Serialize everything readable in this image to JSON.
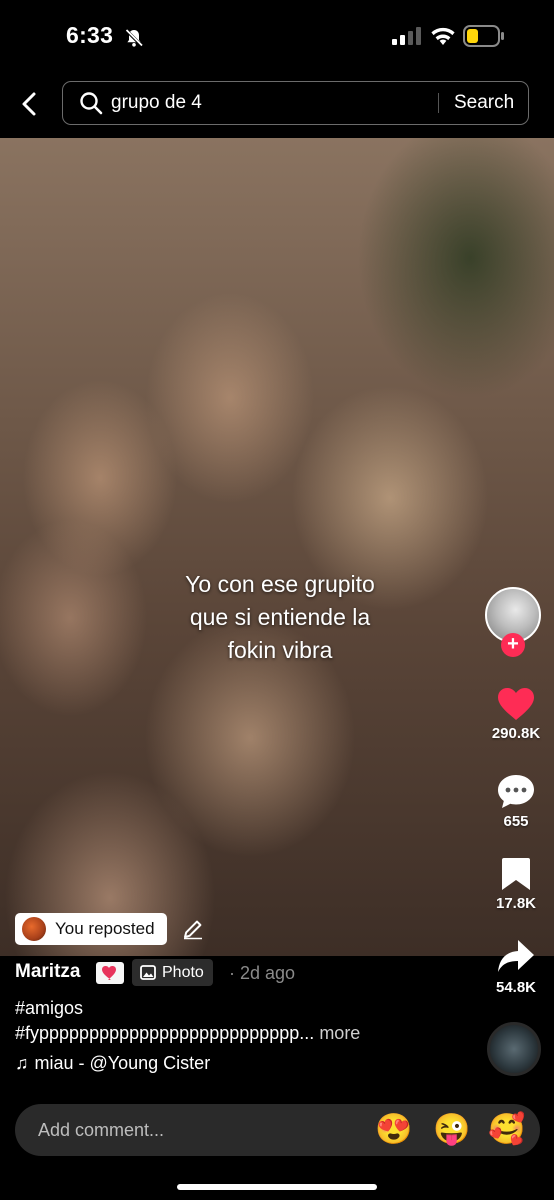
{
  "status": {
    "time": "6:33"
  },
  "search": {
    "query": "grupo de 4",
    "button": "Search"
  },
  "caption": {
    "lines": [
      "Yo con ese grupito",
      "que si entiende la",
      "fokin vibra"
    ]
  },
  "rail": {
    "likes": "290.8K",
    "comments": "655",
    "saves": "17.8K",
    "shares": "54.8K"
  },
  "repost": {
    "label": "You reposted"
  },
  "post": {
    "author": "Maritza",
    "type": "Photo",
    "ago": "· 2d ago",
    "hashtag1": "#amigos",
    "hashtag2": "#fypppppppppppppppppppppppppp...",
    "more": "more",
    "music": "miau - @Young Cister"
  },
  "comment": {
    "placeholder": "Add comment...",
    "emoji1": "😍",
    "emoji2": "😜",
    "emoji3": "🥰"
  },
  "colors": {
    "like": "#fe2c55",
    "background": "#000000",
    "battery": "#ffd60a"
  }
}
